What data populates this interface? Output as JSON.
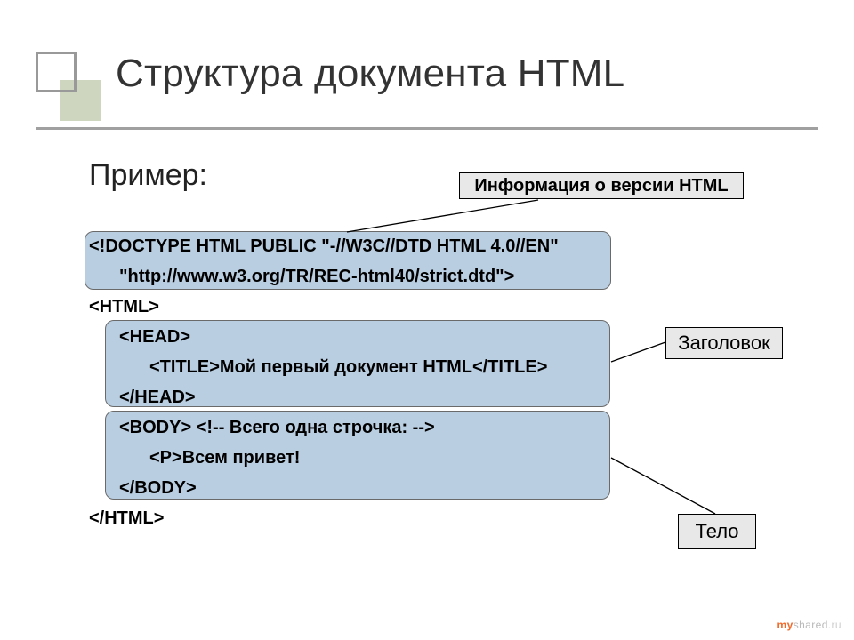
{
  "title": "Структура документа HTML",
  "subtitle": "Пример:",
  "labels": {
    "version": "Информация о версии HTML",
    "header": "Заголовок",
    "body": "Тело"
  },
  "code": {
    "doctype1": "<!DOCTYPE HTML PUBLIC \"-//W3C//DTD HTML 4.0//EN\"",
    "doctype2": "\"http://www.w3.org/TR/REC-html40/strict.dtd\">",
    "html_open": "<HTML>",
    "head_open": "<HEAD>",
    "title_line": "<TITLE>Мой первый документ HTML</TITLE>",
    "head_close": "</HEAD>",
    "body_open": "<BODY> <!-- Всего одна строчка: -->",
    "p_line": "<P>Всем привет!",
    "body_close": "</BODY>",
    "html_close": "</HTML>"
  },
  "watermark": {
    "my": "my",
    "shared": "shared",
    "dot": ".",
    "ru": "ru"
  }
}
